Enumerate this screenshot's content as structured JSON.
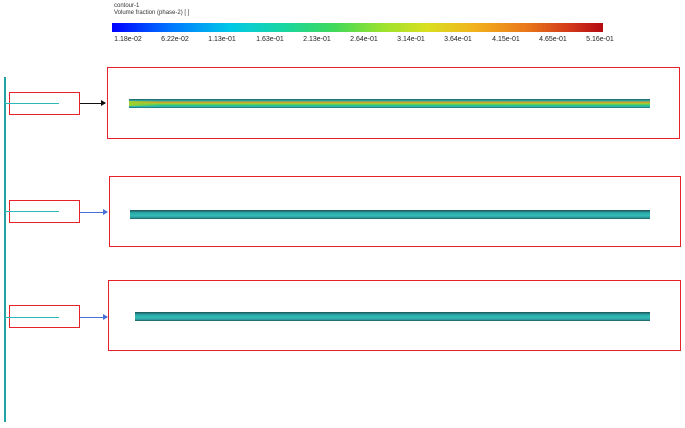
{
  "header": {
    "contour_name": "contour-1",
    "variable": "Volume fraction (phase-2)  [ ]"
  },
  "colorbar": {
    "colors": [
      "#0000ff",
      "#0077ff",
      "#00c8e8",
      "#19d6a0",
      "#3ed95c",
      "#9ae22e",
      "#d9e021",
      "#f2b11c",
      "#ea7a1a",
      "#d33a1a",
      "#b40a12"
    ],
    "tick_labels": [
      "1.18e-02",
      "6.22e-02",
      "1.13e-01",
      "1.63e-01",
      "2.13e-01",
      "2.64e-01",
      "3.14e-01",
      "3.64e-01",
      "4.15e-01",
      "4.65e-01",
      "5.16e-01"
    ]
  },
  "colors": {
    "box_border": "#e8202a",
    "teal": "#2bb7b7",
    "arrow_dark": "#111111",
    "arrow_blue": "#4a6fd6"
  }
}
